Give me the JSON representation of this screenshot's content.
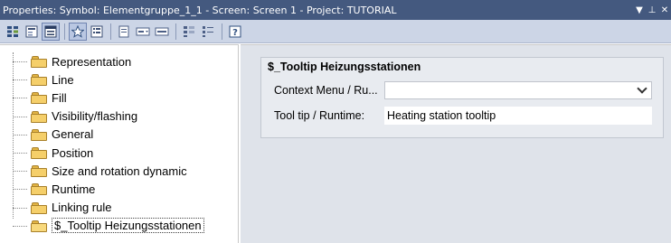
{
  "window": {
    "title": "Properties: Symbol: Elementgruppe_1_1 - Screen: Screen 1 - Project: TUTORIAL",
    "pin_glyph": "▼ ₽ ✕"
  },
  "toolbar": {
    "buttons": [
      {
        "name": "all-properties-icon"
      },
      {
        "name": "grouped-view-icon"
      },
      {
        "name": "tree-view-icon"
      },
      {
        "name": "favorites-star-icon"
      },
      {
        "name": "properties-list-icon"
      },
      {
        "name": "window-icon"
      },
      {
        "name": "dropdown-box-icon"
      },
      {
        "name": "textbox-icon"
      },
      {
        "name": "expand-all-icon"
      },
      {
        "name": "collapse-all-icon"
      },
      {
        "name": "help-icon"
      }
    ],
    "help_glyph": "?"
  },
  "tree": {
    "items": [
      {
        "label": "Representation"
      },
      {
        "label": "Line"
      },
      {
        "label": "Fill"
      },
      {
        "label": "Visibility/flashing"
      },
      {
        "label": "General"
      },
      {
        "label": "Position"
      },
      {
        "label": "Size and rotation dynamic"
      },
      {
        "label": "Runtime"
      },
      {
        "label": "Linking rule"
      },
      {
        "label": "$_Tooltip Heizungsstationen"
      }
    ]
  },
  "properties": {
    "group_title": "$_Tooltip Heizungsstationen",
    "context_menu_label": "Context Menu / Ru...",
    "context_menu_value": "",
    "tooltip_label": "Tool tip / Runtime:",
    "tooltip_value": "Heating station tooltip"
  },
  "colors": {
    "titlebar": "#44597f",
    "toolbar": "#ccd5e6",
    "panel": "#dfe3ea",
    "folder": "#f5cf6a"
  }
}
